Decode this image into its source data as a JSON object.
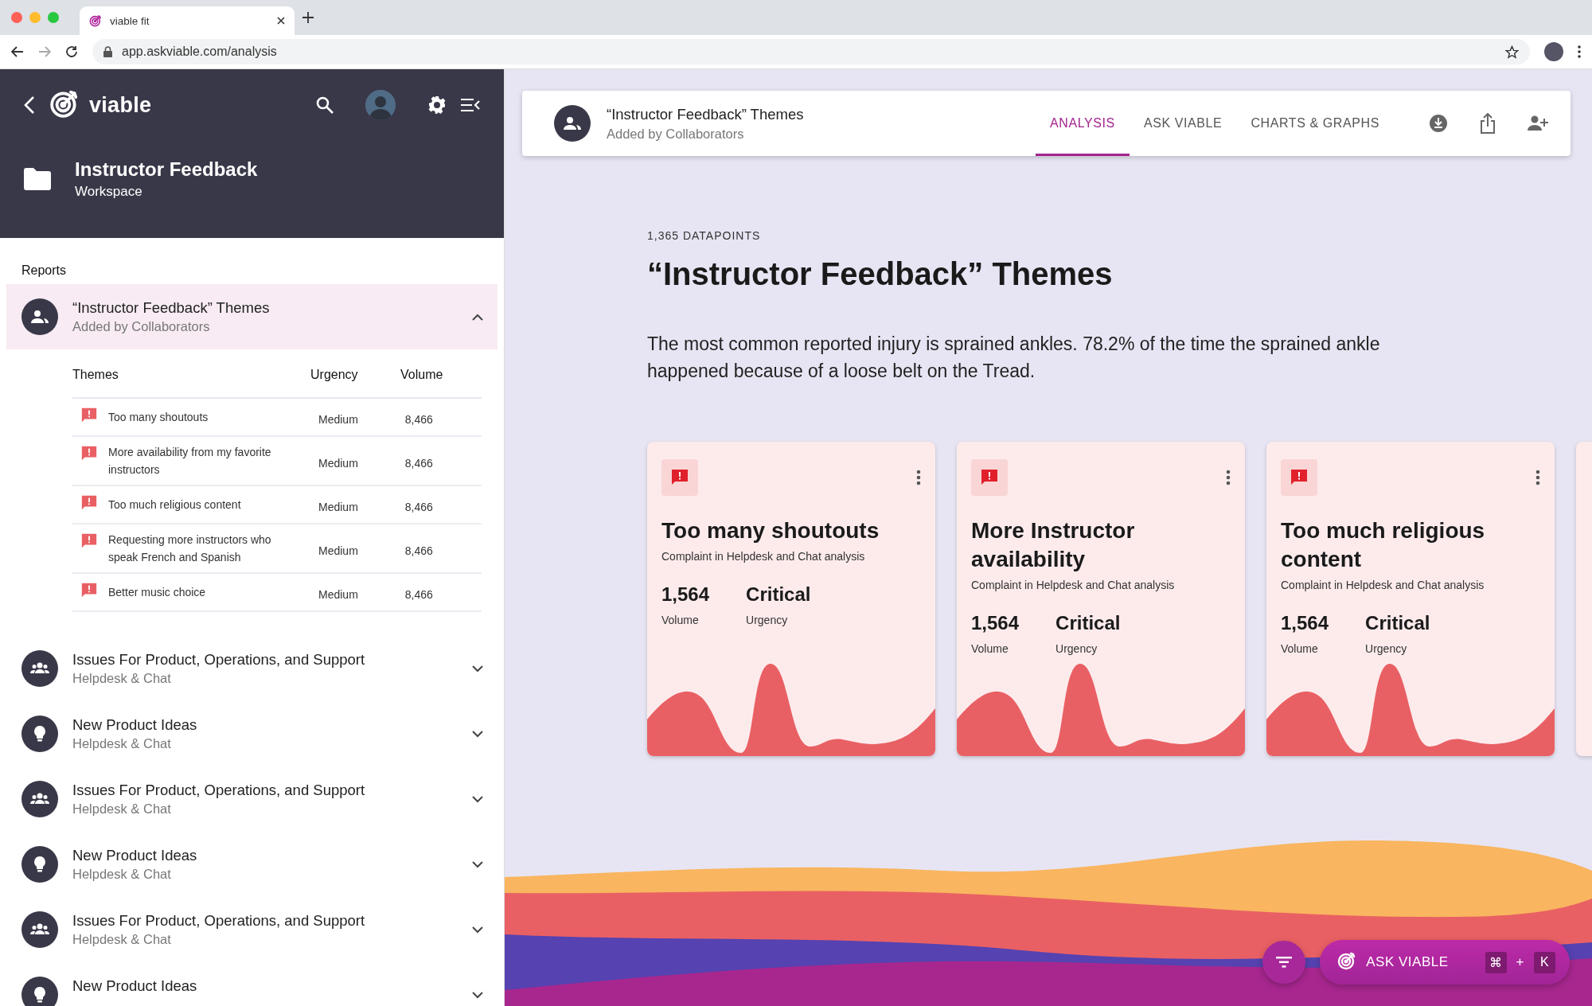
{
  "browser": {
    "tab_title": "viable fit",
    "url": "app.askviable.com/analysis"
  },
  "sidebar": {
    "brand": "viable",
    "workspace": {
      "title": "Instructor Feedback",
      "subtitle": "Workspace"
    },
    "section_label": "Reports",
    "reports": [
      {
        "title": "“Instructor Feedback” Themes",
        "subtitle": "Added by Collaborators",
        "kind": "pair",
        "expanded": true,
        "table": {
          "columns": [
            "Themes",
            "Urgency",
            "Volume"
          ],
          "rows": [
            {
              "theme": "Too many shoutouts",
              "urgency": "Medium",
              "volume": "8,466"
            },
            {
              "theme": "More availability from my favorite instructors",
              "urgency": "Medium",
              "volume": "8,466"
            },
            {
              "theme": "Too much religious content",
              "urgency": "Medium",
              "volume": "8,466"
            },
            {
              "theme": "Requesting more instructors who speak French and Spanish",
              "urgency": "Medium",
              "volume": "8,466"
            },
            {
              "theme": "Better music choice",
              "urgency": "Medium",
              "volume": "8,466"
            }
          ]
        }
      },
      {
        "title": "Issues For Product, Operations, and Support",
        "subtitle": "Helpdesk & Chat",
        "kind": "team",
        "expanded": false
      },
      {
        "title": "New Product Ideas",
        "subtitle": "Helpdesk & Chat",
        "kind": "bulb",
        "expanded": false
      },
      {
        "title": "Issues For Product, Operations, and Support",
        "subtitle": "Helpdesk & Chat",
        "kind": "team",
        "expanded": false
      },
      {
        "title": "New Product Ideas",
        "subtitle": "Helpdesk & Chat",
        "kind": "bulb",
        "expanded": false
      },
      {
        "title": "Issues For Product, Operations, and Support",
        "subtitle": "Helpdesk & Chat",
        "kind": "team",
        "expanded": false
      },
      {
        "title": "New Product Ideas",
        "kind": "bulb",
        "expanded": false
      }
    ]
  },
  "header": {
    "title": "“Instructor Feedback” Themes",
    "subtitle": "Added by Collaborators",
    "tabs": [
      {
        "label": "ANALYSIS",
        "selected": true
      },
      {
        "label": "ASK VIABLE",
        "selected": false
      },
      {
        "label": "CHARTS & GRAPHS",
        "selected": false
      }
    ]
  },
  "content": {
    "count": "1,365 DATAPOINTS",
    "title": "“Instructor Feedback” Themes",
    "summary": "The most common reported injury is sprained ankles. 78.2% of the time the sprained ankle happened because of a loose belt on the Tread.",
    "cards": [
      {
        "title": "Too many shoutouts",
        "subtitle": "Complaint in Helpdesk and Chat analysis",
        "volume": "1,564",
        "volume_label": "Volume",
        "urgency": "Critical",
        "urgency_label": "Urgency"
      },
      {
        "title": "More Instructor availability",
        "subtitle": "Complaint in Helpdesk and Chat analysis",
        "volume": "1,564",
        "volume_label": "Volume",
        "urgency": "Critical",
        "urgency_label": "Urgency"
      },
      {
        "title": "Too much religious content",
        "subtitle": "Complaint in Helpdesk and Chat analysis",
        "volume": "1,564",
        "volume_label": "Volume",
        "urgency": "Critical",
        "urgency_label": "Urgency"
      }
    ]
  },
  "ask_bar": {
    "label": "ASK VIABLE",
    "modifier": "⌘",
    "joiner": "+",
    "key": "K"
  }
}
